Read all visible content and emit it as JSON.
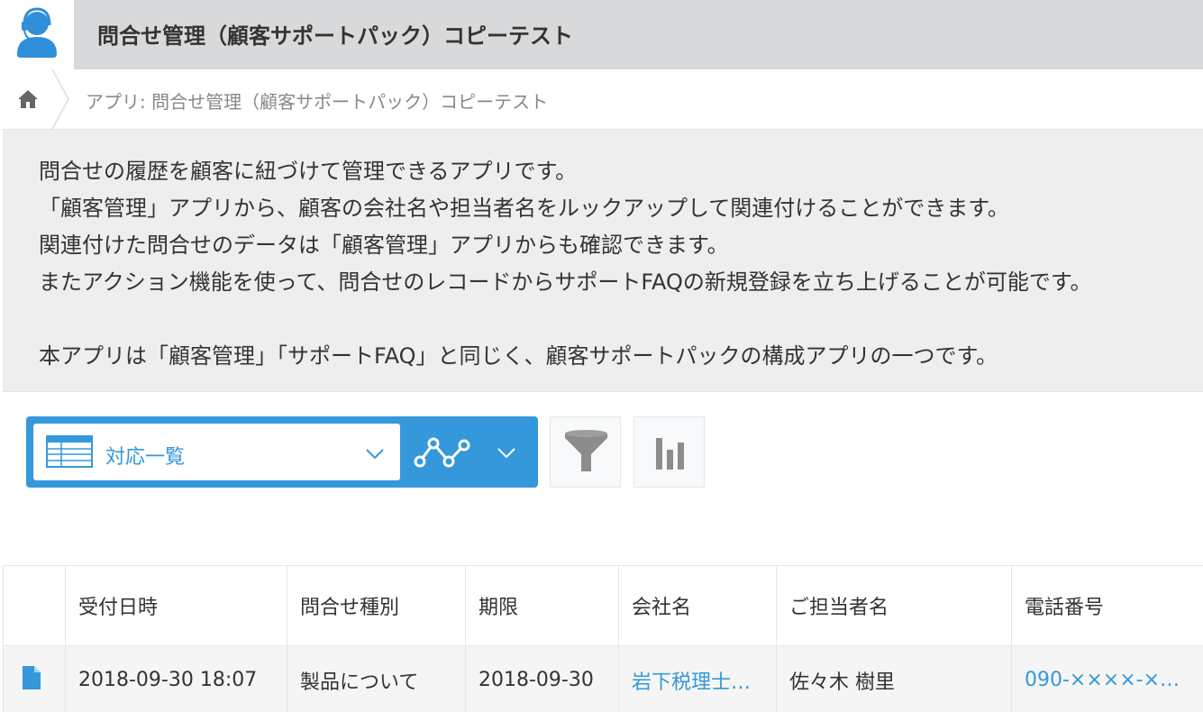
{
  "header": {
    "title": "問合せ管理（顧客サポートパック）コピーテスト",
    "app_icon": "person-headset-icon"
  },
  "breadcrumb": {
    "home_icon": "home-icon",
    "path": "アプリ: 問合せ管理（顧客サポートパック）コピーテスト"
  },
  "description": {
    "lines": [
      "問合せの履歴を顧客に紐づけて管理できるアプリです。",
      "「顧客管理」アプリから、顧客の会社名や担当者名をルックアップして関連付けることができます。",
      "関連付けた問合せのデータは「顧客管理」アプリからも確認できます。",
      "またアクション機能を使って、問合せのレコードからサポートFAQの新規登録を立ち上げることが可能です。",
      "",
      "本アプリは「顧客管理」「サポートFAQ」と同じく、顧客サポートパックの構成アプリの一つです。"
    ]
  },
  "view_bar": {
    "selected_view": "対応一覧",
    "view_icon": "table-view-icon",
    "graph_icon": "line-graph-icon",
    "filter_icon": "funnel-icon",
    "chart_icon": "bar-chart-icon",
    "accent_color": "#3498db"
  },
  "table": {
    "columns": [
      "",
      "受付日時",
      "問合せ種別",
      "期限",
      "会社名",
      "ご担当者名",
      "電話番号"
    ],
    "rows": [
      {
        "icon": "record-detail-icon",
        "received": "2018-09-30 18:07",
        "inquiry_type": "製品について",
        "deadline": "2018-09-30",
        "company": "岩下税理士…",
        "contact": "佐々木 樹里",
        "phone": "090-××××-×…"
      }
    ]
  }
}
